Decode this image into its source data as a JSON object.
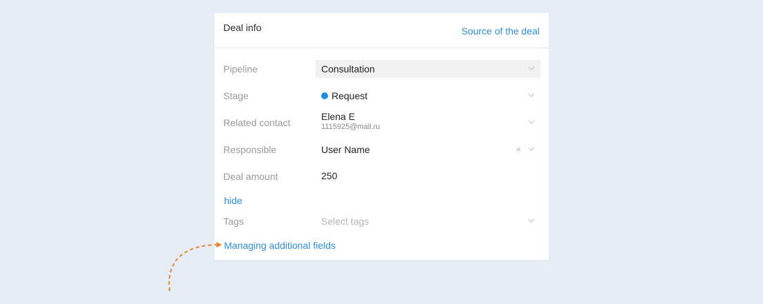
{
  "card": {
    "title": "Deal info",
    "source_link": "Source of the deal"
  },
  "fields": {
    "pipeline": {
      "label": "Pipeline",
      "value": "Consultation"
    },
    "stage": {
      "label": "Stage",
      "value": "Request",
      "dot_color": "#1c8fe0"
    },
    "related_contact": {
      "label": "Related contact",
      "name": "Elena E",
      "email": "1115925@mail.ru"
    },
    "responsible": {
      "label": "Responsible",
      "value": "User Name",
      "clear_glyph": "×"
    },
    "deal_amount": {
      "label": "Deal amount",
      "value": "250"
    },
    "tags": {
      "label": "Tags",
      "placeholder": "Select tags"
    }
  },
  "links": {
    "hide": "hide",
    "managing_fields": "Managing additional fields"
  },
  "colors": {
    "page_bg": "#e6edf6",
    "link": "#2d8fd8",
    "annotation_arrow": "#e8852a"
  },
  "icons": {
    "dropdown": "chevron-down-icon",
    "clear": "close-icon",
    "annotation": "dashed-arrow-icon"
  }
}
